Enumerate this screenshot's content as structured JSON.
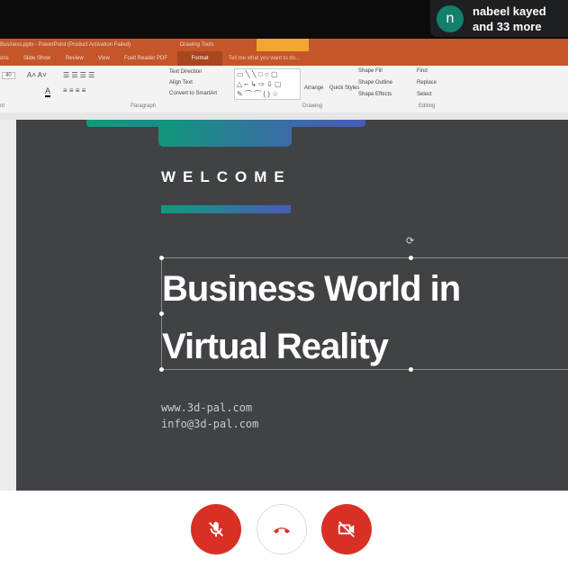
{
  "meeting": {
    "participant_initial": "n",
    "participant_line1": "nabeel kayed",
    "participant_line2": "and 33 more"
  },
  "powerpoint": {
    "title": "Business.pptx - PowerPoint (Product Activation Failed)",
    "context_tab": "Drawing Tools",
    "tabs": [
      "ons",
      "Slide Show",
      "Review",
      "View",
      "Foxit Reader PDF",
      "Format"
    ],
    "tell_me": "Tell me what you want to do...",
    "ribbon": {
      "font_size": "40",
      "text_direction": "Text Direction",
      "align_text": "Align Text",
      "convert_smartart": "Convert to SmartArt",
      "arrange": "Arrange",
      "quick_styles": "Quick Styles",
      "shape_fill": "Shape Fill",
      "shape_outline": "Shape Outline",
      "shape_effects": "Shape Effects",
      "find": "Find",
      "replace": "Replace",
      "select": "Select",
      "groups": {
        "font": "nt",
        "paragraph": "Paragraph",
        "drawing": "Drawing",
        "editing": "Editing"
      }
    }
  },
  "slide": {
    "welcome": "WELCOME",
    "title_line1": "Business World in",
    "title_line2": "Virtual Reality",
    "website": "www.3d-pal.com",
    "email": "info@3d-pal.com",
    "gradient_start": "#0f9b7a",
    "gradient_end": "#4a5cb8"
  },
  "controls": {
    "mic_state": "off",
    "camera_state": "off"
  }
}
